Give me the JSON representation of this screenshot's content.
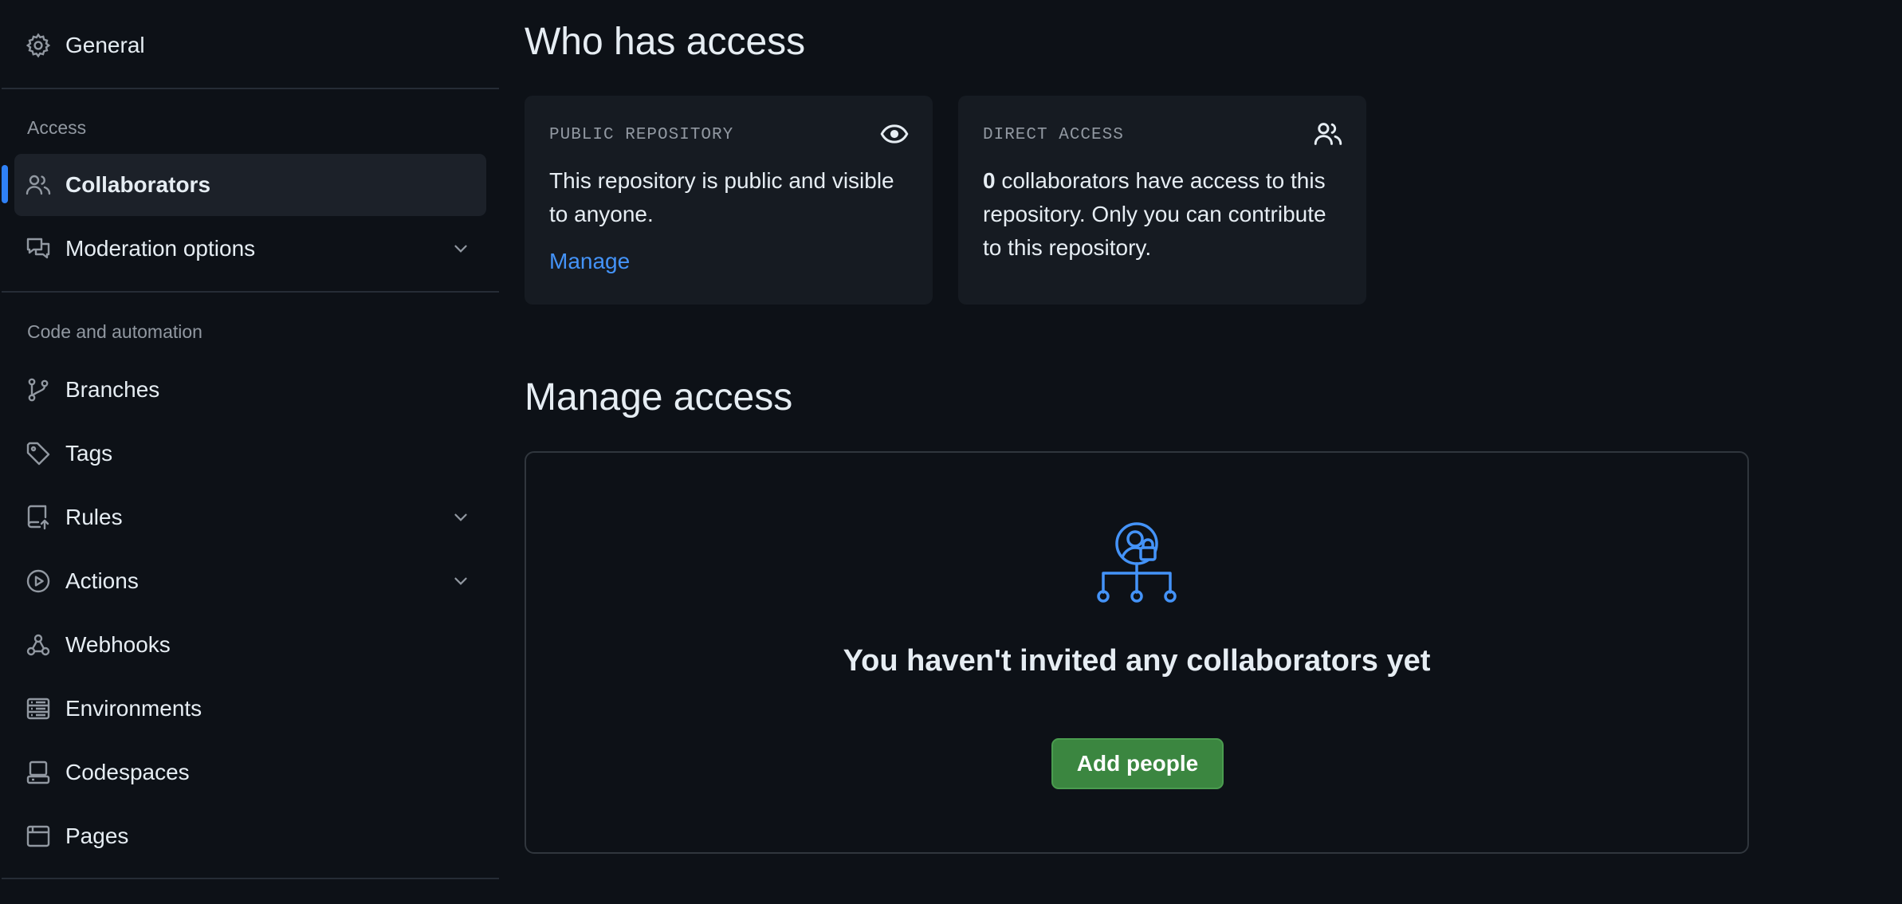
{
  "sidebar": {
    "general": {
      "label": "General",
      "icon": "gear-icon"
    },
    "sections": {
      "access": "Access",
      "code_automation": "Code and automation"
    },
    "access_items": [
      {
        "label": "Collaborators",
        "icon": "people-icon",
        "active": true
      },
      {
        "label": "Moderation options",
        "icon": "comment-discussion-icon",
        "expandable": true
      }
    ],
    "code_items": [
      {
        "label": "Branches",
        "icon": "git-branch-icon"
      },
      {
        "label": "Tags",
        "icon": "tag-icon"
      },
      {
        "label": "Rules",
        "icon": "repo-push-icon",
        "expandable": true
      },
      {
        "label": "Actions",
        "icon": "play-icon",
        "expandable": true
      },
      {
        "label": "Webhooks",
        "icon": "webhook-icon"
      },
      {
        "label": "Environments",
        "icon": "server-icon"
      },
      {
        "label": "Codespaces",
        "icon": "codespaces-icon"
      },
      {
        "label": "Pages",
        "icon": "browser-icon"
      }
    ]
  },
  "who_has_access": {
    "title": "Who has access",
    "public_card": {
      "kicker": "PUBLIC REPOSITORY",
      "body": "This repository is public and visible to anyone.",
      "link": "Manage",
      "icon": "eye-icon"
    },
    "direct_card": {
      "kicker": "DIRECT ACCESS",
      "count": "0",
      "body": " collaborators have access to this repository. Only you can contribute to this repository.",
      "icon": "people-icon"
    }
  },
  "manage_access": {
    "title": "Manage access",
    "empty_title": "You haven't invited any collaborators yet",
    "button": "Add people",
    "illustration": "person-lock-org-icon"
  },
  "colors": {
    "background": "#0d1117",
    "accent_blue": "#2f81f7",
    "link": "#4493f8",
    "primary_button": "#3b8640",
    "muted_text": "#9198a1"
  }
}
